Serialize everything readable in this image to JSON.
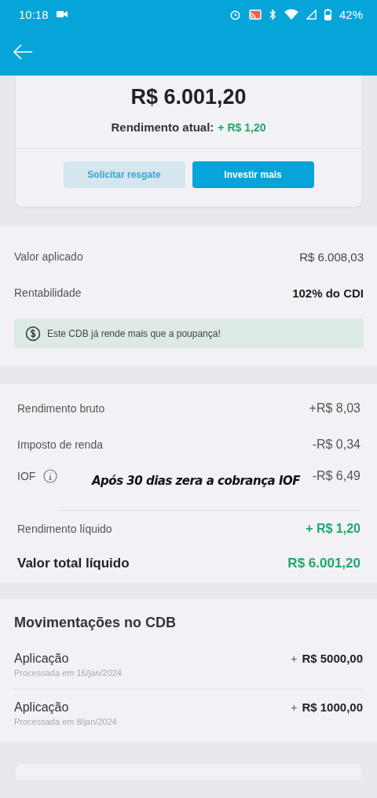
{
  "status_bar": {
    "time": "10:18",
    "battery": "42%"
  },
  "summary": {
    "total": "R$ 6.001,20",
    "yield_label": "Rendimento atual:",
    "yield_value": "+ R$ 1,20",
    "buttons": [
      {
        "label": "Solicitar resgate",
        "kind": "secondary"
      },
      {
        "label": "Investir mais",
        "kind": "primary"
      }
    ]
  },
  "details": {
    "rows": [
      {
        "label": "Valor aplicado",
        "value": "R$ 6.008,03",
        "bold": false
      },
      {
        "label": "Rentabilidade",
        "value": "102% do CDI",
        "bold": true
      }
    ],
    "notice": "Este CDB já rende mais que a poupança!"
  },
  "breakdown": {
    "rows": [
      {
        "label": "Rendimento bruto",
        "value": "+R$ 8,03",
        "kind": "neutral",
        "info": false
      },
      {
        "label": "Imposto de renda",
        "value": "-R$ 0,34",
        "kind": "neutral",
        "info": false
      },
      {
        "label": "IOF",
        "value": "-R$ 6,49",
        "kind": "neutral",
        "info": true,
        "annotation": "Após 30 dias zera a cobrança IOF"
      },
      {
        "label": "Rendimento líquido",
        "value": "+ R$ 1,20",
        "kind": "positive",
        "info": false
      },
      {
        "label": "Valor total líquido",
        "value": "R$ 6.001,20",
        "kind": "total",
        "info": false
      }
    ]
  },
  "movements": {
    "title": "Movimentações no CDB",
    "items": [
      {
        "title": "Aplicação",
        "date": "Processada em 16/jan/2024",
        "sign": "+",
        "amount": "R$ 5000,00"
      },
      {
        "title": "Aplicação",
        "date": "Processada em 8/jan/2024",
        "sign": "+",
        "amount": "R$ 1000,00"
      }
    ]
  }
}
